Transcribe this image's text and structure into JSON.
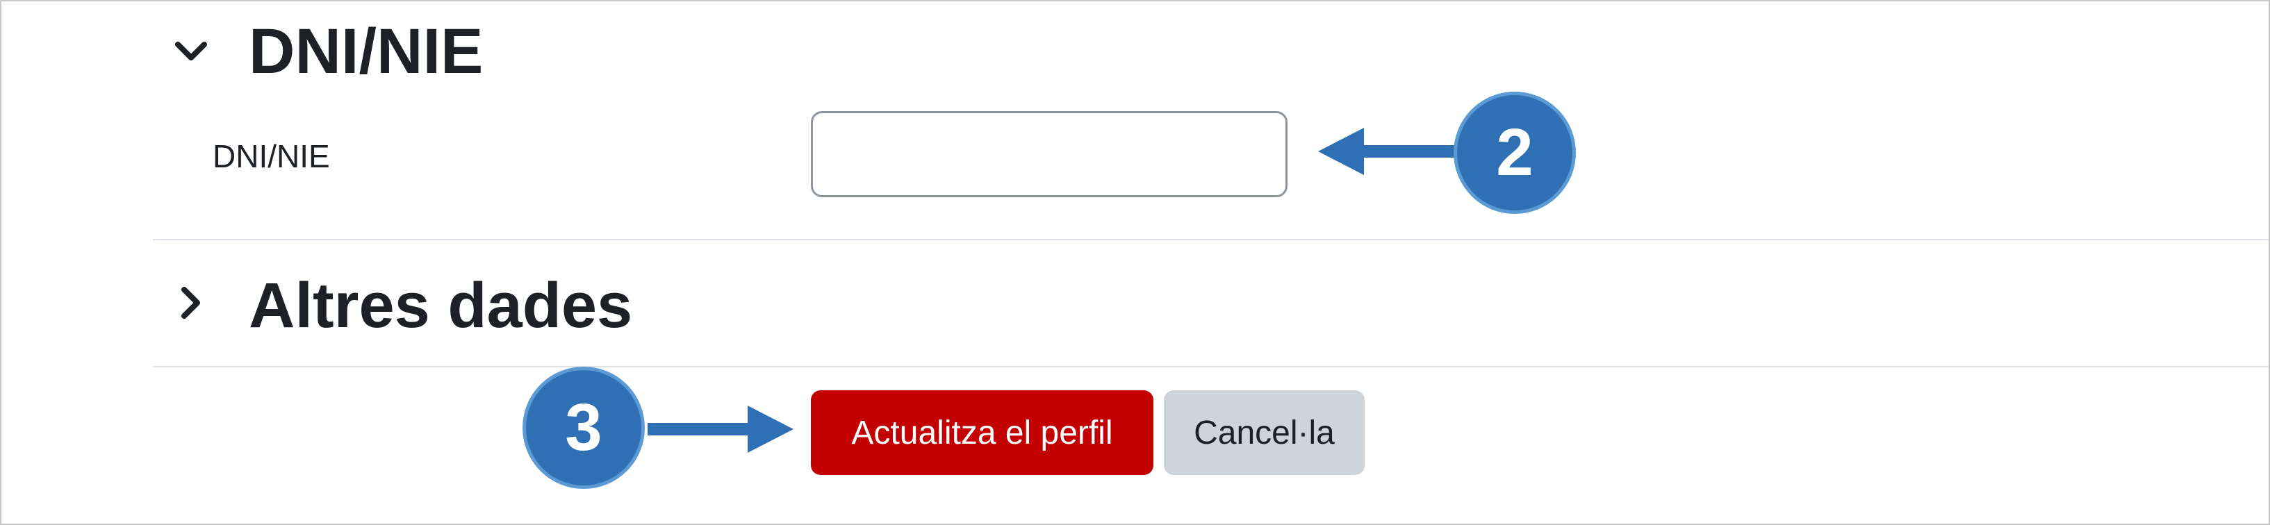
{
  "sections": {
    "dni": {
      "title": "DNI/NIE",
      "toggle_icon": "chevron-down-icon",
      "field_label": "DNI/NIE",
      "field_value": ""
    },
    "other": {
      "title": "Altres dades",
      "toggle_icon": "chevron-right-icon"
    }
  },
  "actions": {
    "update_label": "Actualitza el perfil",
    "cancel_label": "Cancel·la"
  },
  "annotations": {
    "step_2": "2",
    "step_3": "3"
  },
  "colors": {
    "primary_button": "#c30000",
    "secondary_button": "#ced4da",
    "annotation_blue": "#2e70b3",
    "text": "#1d2125"
  }
}
